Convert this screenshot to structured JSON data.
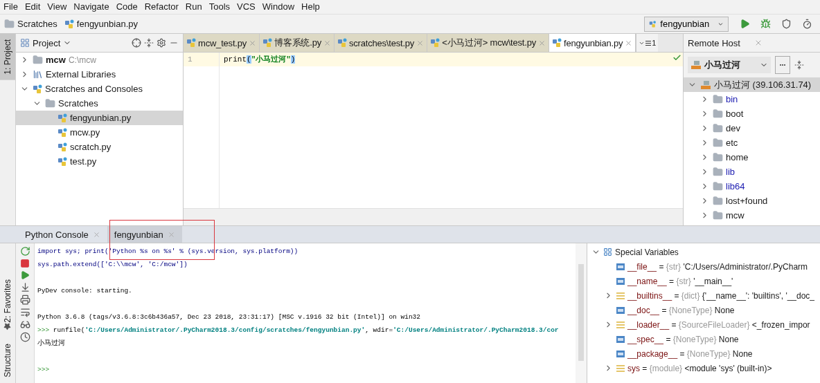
{
  "menu": [
    "File",
    "Edit",
    "View",
    "Navigate",
    "Code",
    "Refactor",
    "Run",
    "Tools",
    "VCS",
    "Window",
    "Help"
  ],
  "breadcrumb": [
    {
      "label": "Scratches",
      "kind": "folder"
    },
    {
      "label": "fengyunbian.py",
      "kind": "file"
    }
  ],
  "run_config": {
    "label": "fengyunbian"
  },
  "left_stripe": [
    {
      "label": "1: Project",
      "selected": true
    }
  ],
  "project_panel": {
    "title": "Project",
    "tree": [
      {
        "label": "mcw",
        "hint": "C:\\mcw",
        "kind": "module",
        "expanded": false,
        "selected": false
      },
      {
        "label": "External Libraries",
        "kind": "library",
        "expanded": false,
        "selected": false
      },
      {
        "label": "Scratches and Consoles",
        "kind": "scratches",
        "expanded": true,
        "selected": false,
        "children": [
          {
            "label": "Scratches",
            "kind": "folder",
            "expanded": true,
            "selected": false,
            "children": [
              {
                "label": "fengyunbian.py",
                "kind": "file",
                "selected": true
              },
              {
                "label": "mcw.py",
                "kind": "file",
                "selected": false
              },
              {
                "label": "scratch.py",
                "kind": "file",
                "selected": false
              },
              {
                "label": "test.py",
                "kind": "file",
                "selected": false
              }
            ]
          }
        ]
      }
    ]
  },
  "editor": {
    "tabs": [
      {
        "label": "mcw_test.py",
        "selected": false
      },
      {
        "label": "博客系统.py",
        "selected": false
      },
      {
        "label": "scratches\\test.py",
        "selected": false
      },
      {
        "label": "<小马过河> mcw\\test.py",
        "selected": false
      },
      {
        "label": "fengyunbian.py",
        "selected": true
      }
    ],
    "overflow_count": "1",
    "lines": [
      {
        "number": "1",
        "current": true,
        "tokens": [
          {
            "kind": "name",
            "text": "print"
          },
          {
            "kind": "brace",
            "text": "("
          },
          {
            "kind": "string",
            "text": "\"小马过河\""
          },
          {
            "kind": "brace",
            "text": ")"
          }
        ]
      }
    ]
  },
  "remote_host": {
    "title": "Remote Host",
    "server": "小马过河",
    "root": {
      "label": "小马过河 (39.106.31.74)",
      "expanded": true,
      "children": [
        {
          "label": "bin",
          "highlighted": true
        },
        {
          "label": "boot",
          "highlighted": false
        },
        {
          "label": "dev",
          "highlighted": false
        },
        {
          "label": "etc",
          "highlighted": false
        },
        {
          "label": "home",
          "highlighted": false
        },
        {
          "label": "lib",
          "highlighted": true
        },
        {
          "label": "lib64",
          "highlighted": true
        },
        {
          "label": "lost+found",
          "highlighted": false
        },
        {
          "label": "mcw",
          "highlighted": false
        }
      ]
    }
  },
  "bottom_stripe": [
    {
      "label": "2: Favorites"
    },
    {
      "label": "Structure"
    }
  ],
  "bottom_tabs": [
    {
      "label": "Python Console",
      "selected": false
    },
    {
      "label": "fengyunbian",
      "selected": true
    }
  ],
  "console": [
    {
      "kind": "echo",
      "text": "import sys; print('Python %s on %s' % (sys.version, sys.platform))"
    },
    {
      "kind": "echo",
      "text": "sys.path.extend(['C:\\\\mcw', 'C:/mcw'])"
    },
    {
      "kind": "blank"
    },
    {
      "kind": "output",
      "text": "PyDev console: starting."
    },
    {
      "kind": "blank"
    },
    {
      "kind": "output",
      "text": "Python 3.6.8 (tags/v3.6.8:3c6b436a57, Dec 23 2018, 23:31:17) [MSC v.1916 32 bit (Intel)] on win32"
    },
    {
      "kind": "command",
      "prompt": ">>>",
      "segments": [
        {
          "kind": "code",
          "text": "runfile("
        },
        {
          "kind": "string",
          "text": "'C:/Users/Administrator/.PyCharm2018.3/config/scratches/fengyunbian.py'"
        },
        {
          "kind": "code",
          "text": ", wdir="
        },
        {
          "kind": "string",
          "text": "'C:/Users/Administrator/.PyCharm2018.3/cor"
        }
      ]
    },
    {
      "kind": "output",
      "text": "小马过河"
    },
    {
      "kind": "blank"
    },
    {
      "kind": "prompt",
      "text": ">>>"
    }
  ],
  "variables": {
    "title": "Special Variables",
    "expanded": true,
    "separator": "=",
    "items": [
      {
        "kind": "value",
        "expandable": false,
        "name": "__file__",
        "type": "{str}",
        "value": "'C:/Users/Administrator/.PyCharm"
      },
      {
        "kind": "value",
        "expandable": false,
        "name": "__name__",
        "type": "{str}",
        "value": "'__main__'"
      },
      {
        "kind": "collection",
        "expandable": true,
        "name": "__builtins__",
        "type": "{dict}",
        "value": "{'__name__': 'builtins', '__doc_"
      },
      {
        "kind": "value",
        "expandable": false,
        "name": "__doc__",
        "type": "{NoneType}",
        "value": "None"
      },
      {
        "kind": "collection",
        "expandable": true,
        "name": "__loader__",
        "type": "{SourceFileLoader}",
        "value": "<_frozen_impor"
      },
      {
        "kind": "value",
        "expandable": false,
        "name": "__spec__",
        "type": "{NoneType}",
        "value": "None"
      },
      {
        "kind": "value",
        "expandable": false,
        "name": "__package__",
        "type": "{NoneType}",
        "value": "None"
      },
      {
        "kind": "collection",
        "expandable": true,
        "name": "sys",
        "type": "{module}",
        "value": "<module 'sys' (built-in)>"
      }
    ]
  }
}
